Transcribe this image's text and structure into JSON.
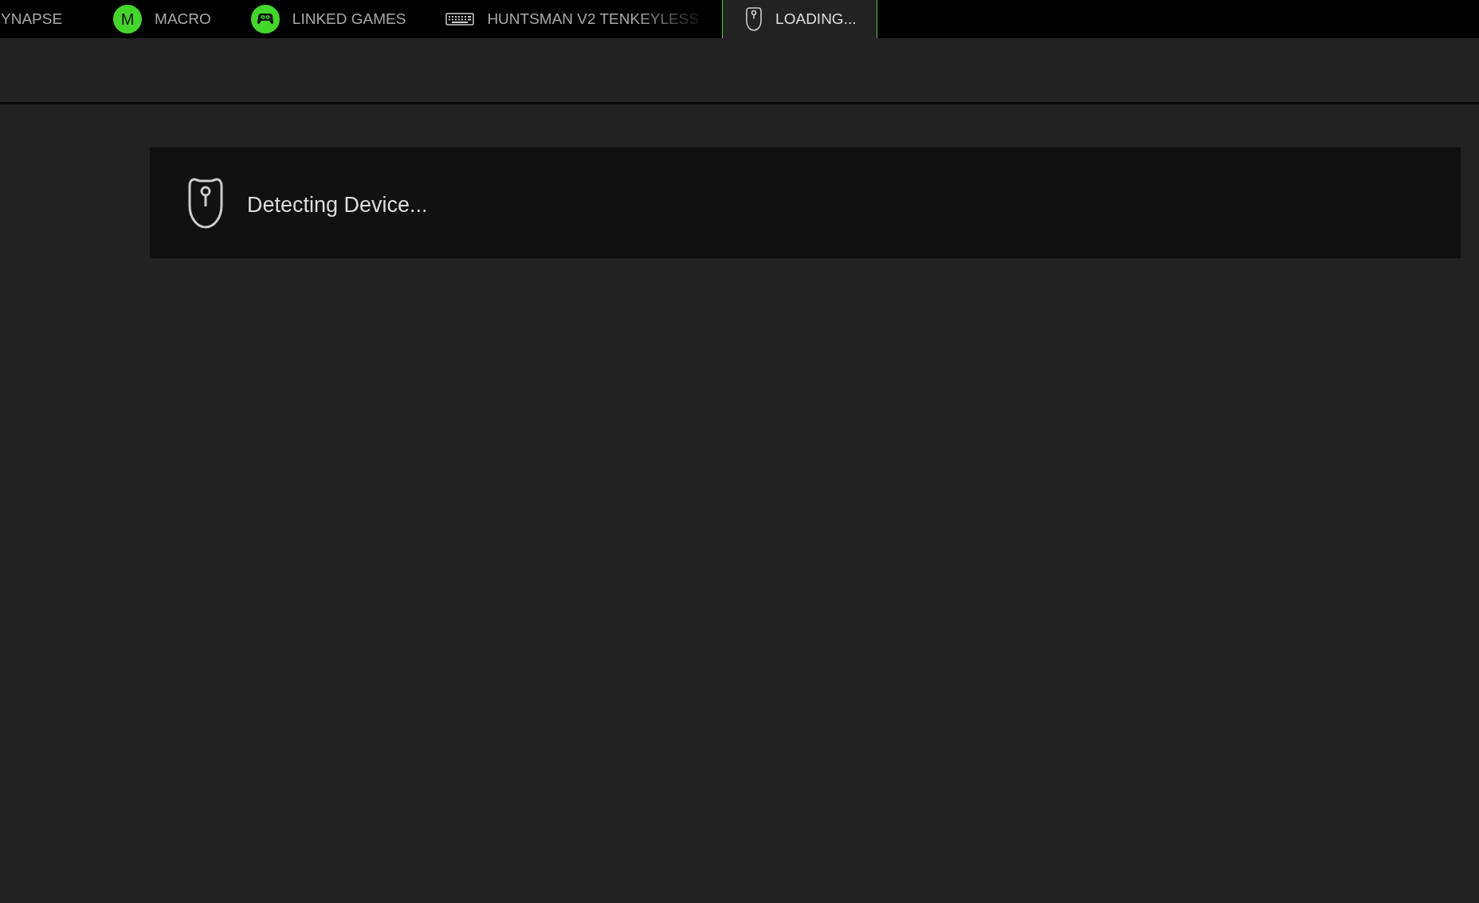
{
  "tabs": [
    {
      "label": "YNAPSE",
      "kind": "plain",
      "selected": false
    },
    {
      "label": "MACRO",
      "kind": "badge",
      "badge": "M",
      "selected": false
    },
    {
      "label": "LINKED GAMES",
      "kind": "gamepad",
      "selected": false
    },
    {
      "label": "HUNTSMAN V2 TENKEYLESS",
      "kind": "keyboard",
      "selected": false,
      "faded": true
    },
    {
      "label": "LOADING...",
      "kind": "mouse",
      "selected": true
    }
  ],
  "status": {
    "message": "Detecting Device..."
  }
}
